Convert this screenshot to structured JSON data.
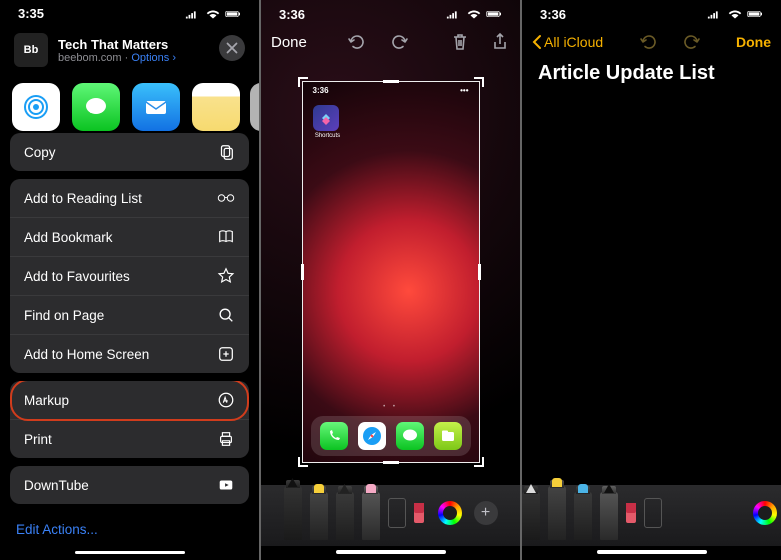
{
  "panel1": {
    "statusTime": "3:35",
    "pageTitle": "Tech That Matters",
    "domain": "beebom.com",
    "optionsLabel": "Options",
    "optionsChevron": "›",
    "apps": [
      {
        "label": "AirDrop"
      },
      {
        "label": "Messages"
      },
      {
        "label": "Mail"
      },
      {
        "label": "Notes"
      },
      {
        "label": "Re"
      }
    ],
    "copyLabel": "Copy",
    "actions": [
      {
        "label": "Add to Reading List"
      },
      {
        "label": "Add Bookmark"
      },
      {
        "label": "Add to Favourites"
      },
      {
        "label": "Find on Page"
      },
      {
        "label": "Add to Home Screen"
      }
    ],
    "markupLabel": "Markup",
    "printLabel": "Print",
    "downTubeLabel": "DownTube",
    "editActions": "Edit Actions..."
  },
  "panel2": {
    "statusTime": "3:36",
    "done": "Done",
    "innerTime": "3:36",
    "shortcutsLabel": "Shortcuts",
    "plus": "+"
  },
  "panel3": {
    "statusTime": "3:36",
    "backLabel": "All iCloud",
    "done": "Done",
    "noteTitle": "Article Update List"
  }
}
